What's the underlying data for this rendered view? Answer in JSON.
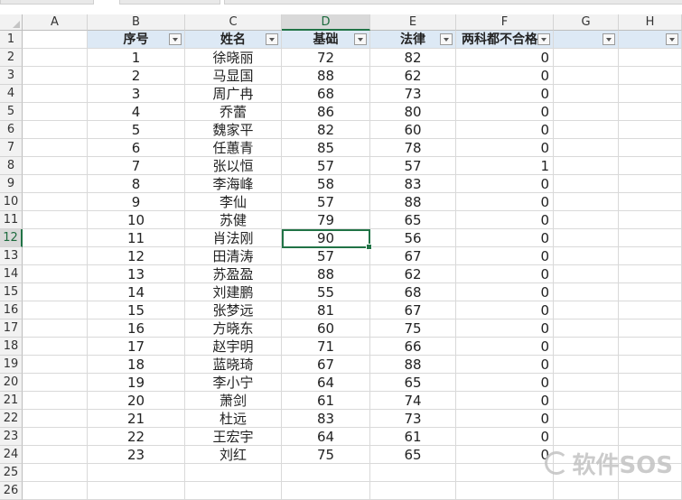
{
  "columns": [
    "A",
    "B",
    "C",
    "D",
    "E",
    "F",
    "G",
    "H"
  ],
  "selected_column": "D",
  "selected_row": 12,
  "header_row": {
    "seq": "序号",
    "name": "姓名",
    "basic": "基础",
    "law": "法律",
    "fail_both": "两科都不合格"
  },
  "rows": [
    {
      "seq": "1",
      "name": "徐晓丽",
      "basic": "72",
      "law": "82",
      "fail_both": "0"
    },
    {
      "seq": "2",
      "name": "马显国",
      "basic": "88",
      "law": "62",
      "fail_both": "0"
    },
    {
      "seq": "3",
      "name": "周广冉",
      "basic": "68",
      "law": "73",
      "fail_both": "0"
    },
    {
      "seq": "4",
      "name": "乔蕾",
      "basic": "86",
      "law": "80",
      "fail_both": "0"
    },
    {
      "seq": "5",
      "name": "魏家平",
      "basic": "82",
      "law": "60",
      "fail_both": "0"
    },
    {
      "seq": "6",
      "name": "任蕙青",
      "basic": "85",
      "law": "78",
      "fail_both": "0"
    },
    {
      "seq": "7",
      "name": "张以恒",
      "basic": "57",
      "law": "57",
      "fail_both": "1"
    },
    {
      "seq": "8",
      "name": "李海峰",
      "basic": "58",
      "law": "83",
      "fail_both": "0"
    },
    {
      "seq": "9",
      "name": "李仙",
      "basic": "57",
      "law": "88",
      "fail_both": "0"
    },
    {
      "seq": "10",
      "name": "苏健",
      "basic": "79",
      "law": "65",
      "fail_both": "0"
    },
    {
      "seq": "11",
      "name": "肖法刚",
      "basic": "90",
      "law": "56",
      "fail_both": "0"
    },
    {
      "seq": "12",
      "name": "田清涛",
      "basic": "57",
      "law": "67",
      "fail_both": "0"
    },
    {
      "seq": "13",
      "name": "苏盈盈",
      "basic": "88",
      "law": "62",
      "fail_both": "0"
    },
    {
      "seq": "14",
      "name": "刘建鹏",
      "basic": "55",
      "law": "68",
      "fail_both": "0"
    },
    {
      "seq": "15",
      "name": "张梦远",
      "basic": "81",
      "law": "67",
      "fail_both": "0"
    },
    {
      "seq": "16",
      "name": "方晓东",
      "basic": "60",
      "law": "75",
      "fail_both": "0"
    },
    {
      "seq": "17",
      "name": "赵宇明",
      "basic": "71",
      "law": "66",
      "fail_both": "0"
    },
    {
      "seq": "18",
      "name": "蓝晓琦",
      "basic": "67",
      "law": "88",
      "fail_both": "0"
    },
    {
      "seq": "19",
      "name": "李小宁",
      "basic": "64",
      "law": "65",
      "fail_both": "0"
    },
    {
      "seq": "20",
      "name": "萧剑",
      "basic": "61",
      "law": "74",
      "fail_both": "0"
    },
    {
      "seq": "21",
      "name": "杜远",
      "basic": "83",
      "law": "73",
      "fail_both": "0"
    },
    {
      "seq": "22",
      "name": "王宏宇",
      "basic": "64",
      "law": "61",
      "fail_both": "0"
    },
    {
      "seq": "23",
      "name": "刘红",
      "basic": "75",
      "law": "65",
      "fail_both": "0"
    }
  ],
  "colors": {
    "header_fill": "#dde9f5",
    "selection_green": "#217346",
    "gridline": "#d9d9d9"
  },
  "watermark": "软件SOS"
}
